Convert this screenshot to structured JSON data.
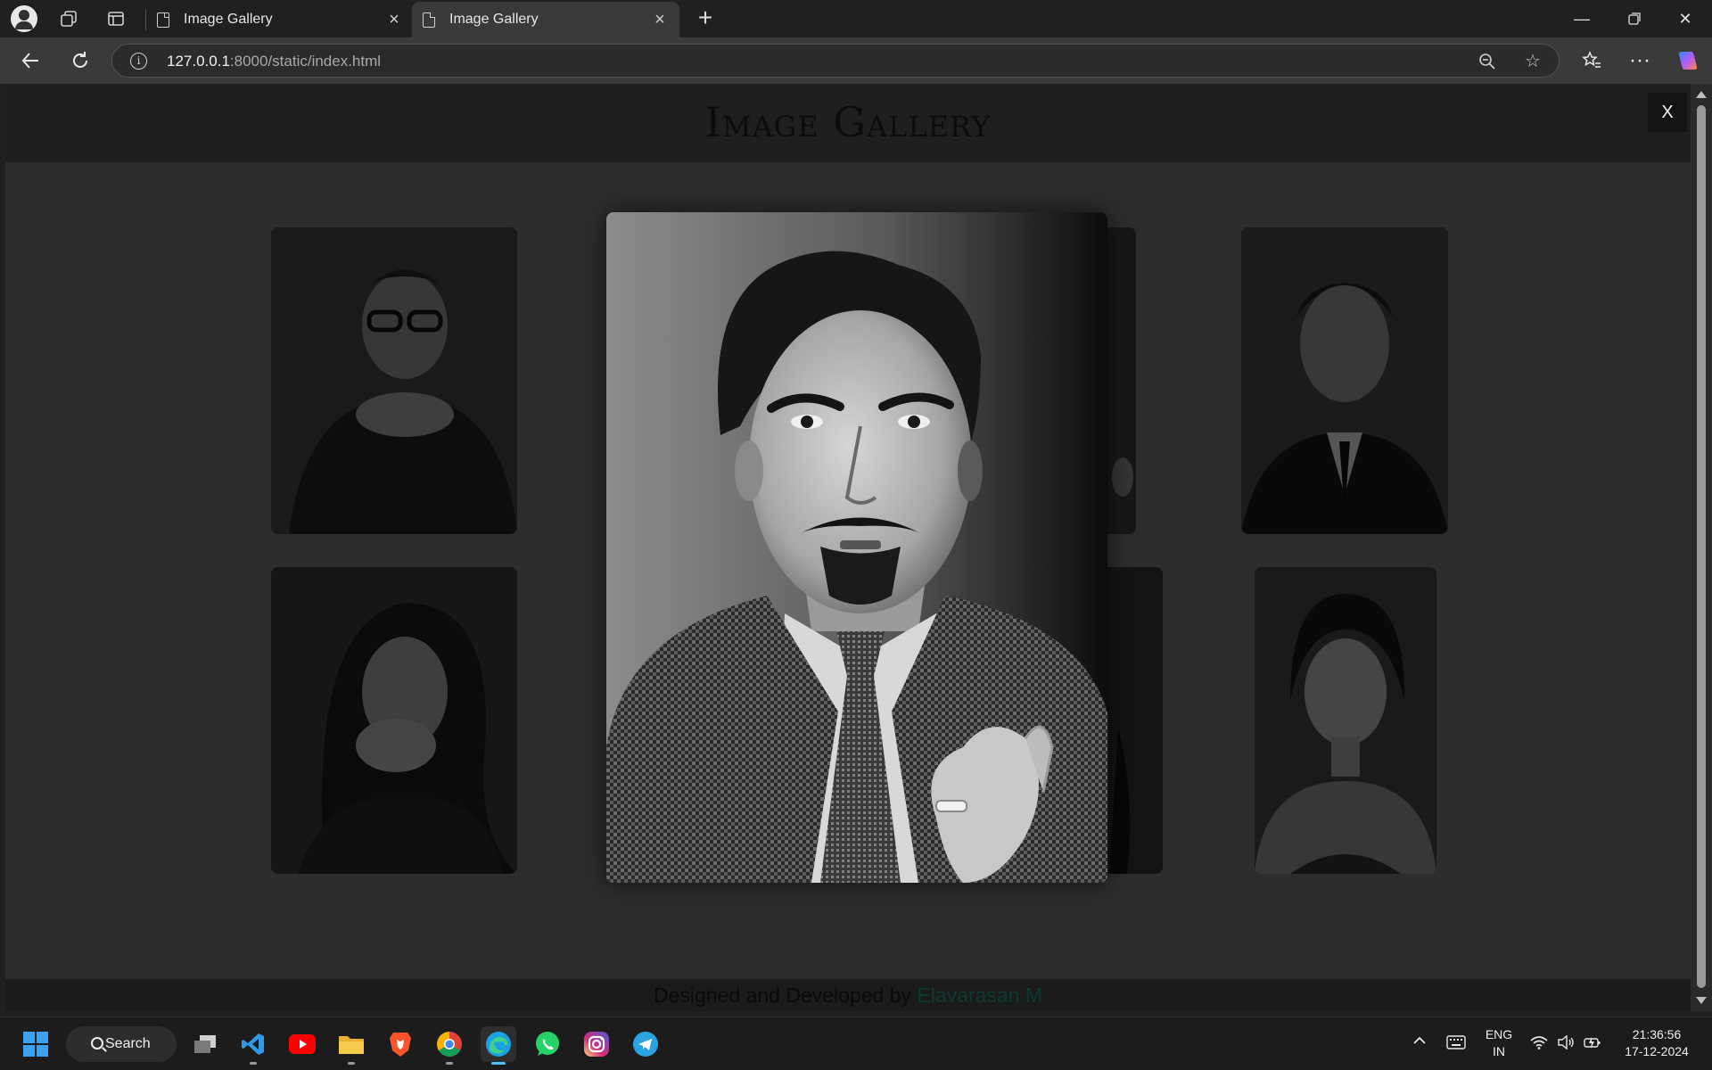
{
  "browser": {
    "tabs": [
      {
        "title": "Image Gallery",
        "active": false
      },
      {
        "title": "Image Gallery",
        "active": true
      }
    ],
    "url_host": "127.0.0.1",
    "url_rest": ":8000/static/index.html"
  },
  "page": {
    "title": "Image Gallery",
    "close_label": "X",
    "footer_prefix": "Designed and Developed by ",
    "footer_author": "Elavarasan M"
  },
  "gallery": {
    "items": [
      {
        "name": "portrait-man-glasses"
      },
      {
        "name": "portrait-man-partially-hidden"
      },
      {
        "name": "portrait-man-suit"
      },
      {
        "name": "portrait-woman-dark-hair"
      },
      {
        "name": "portrait-partially-hidden-2"
      },
      {
        "name": "portrait-woman-light"
      }
    ],
    "featured": {
      "name": "portrait-man-goatee-checked-suit"
    }
  },
  "taskbar": {
    "search_label": "Search",
    "lang_line1": "ENG",
    "lang_line2": "IN",
    "time": "21:36:56",
    "date": "17-12-2024"
  },
  "colors": {
    "accent": "#4cc2ff",
    "footer_author": "#0d3b32"
  }
}
